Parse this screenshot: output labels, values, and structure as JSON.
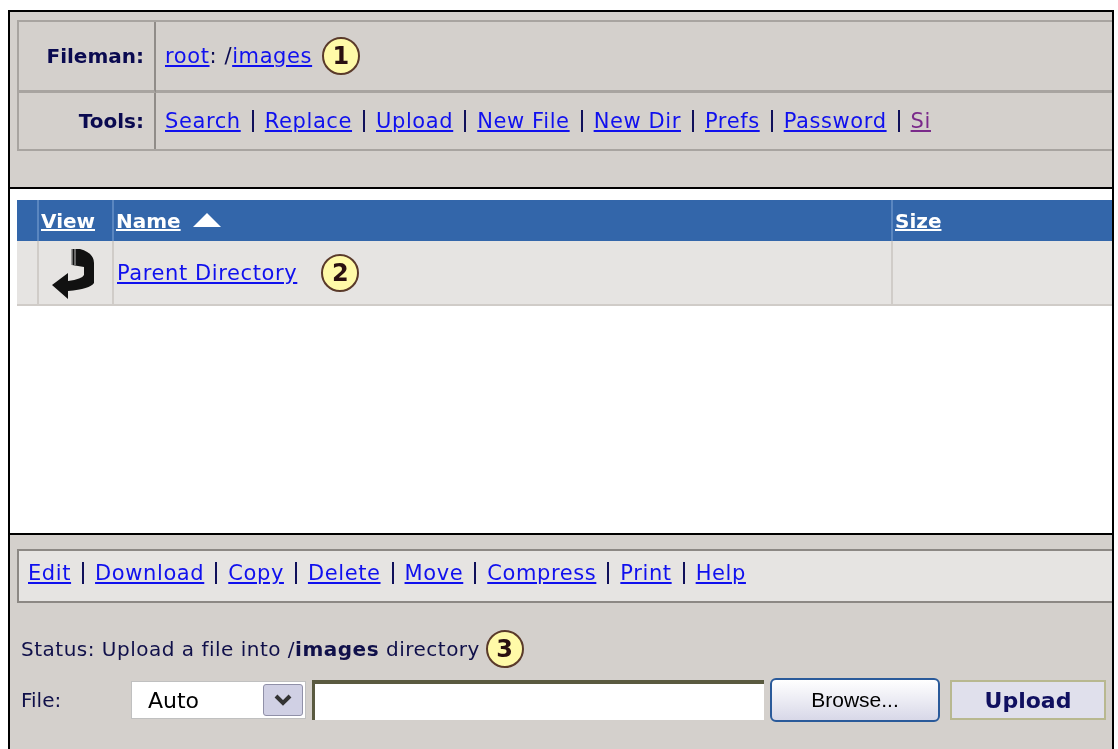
{
  "location": {
    "label": "Fileman:",
    "parts": [
      {
        "text": "root",
        "link": true
      },
      {
        "text": ": /",
        "link": false
      },
      {
        "text": "images",
        "link": true
      }
    ],
    "callout": "1"
  },
  "tools": {
    "label": "Tools:",
    "links": [
      {
        "label": "Search",
        "visited": false
      },
      {
        "label": "Replace",
        "visited": false
      },
      {
        "label": "Upload",
        "visited": false
      },
      {
        "label": "New File",
        "visited": false
      },
      {
        "label": "New Dir",
        "visited": false
      },
      {
        "label": "Prefs",
        "visited": false
      },
      {
        "label": "Password",
        "visited": false
      },
      {
        "label": "Si",
        "visited": true
      }
    ]
  },
  "table": {
    "columns": [
      {
        "label": "View",
        "sorted": false
      },
      {
        "label": "Name",
        "sorted": true
      },
      {
        "label": "Size",
        "sorted": false
      }
    ],
    "rows": [
      {
        "kind": "parent",
        "name": "Parent Directory",
        "callout": "2"
      }
    ]
  },
  "actions": [
    "Edit",
    "Download",
    "Copy",
    "Delete",
    "Move",
    "Compress",
    "Print",
    "Help"
  ],
  "status": {
    "text": "Status: Upload a file into /**images** directory",
    "callout": "3"
  },
  "upload": {
    "label": "File:",
    "mode": "Auto",
    "browse": "Browse...",
    "submit": "Upload"
  }
}
